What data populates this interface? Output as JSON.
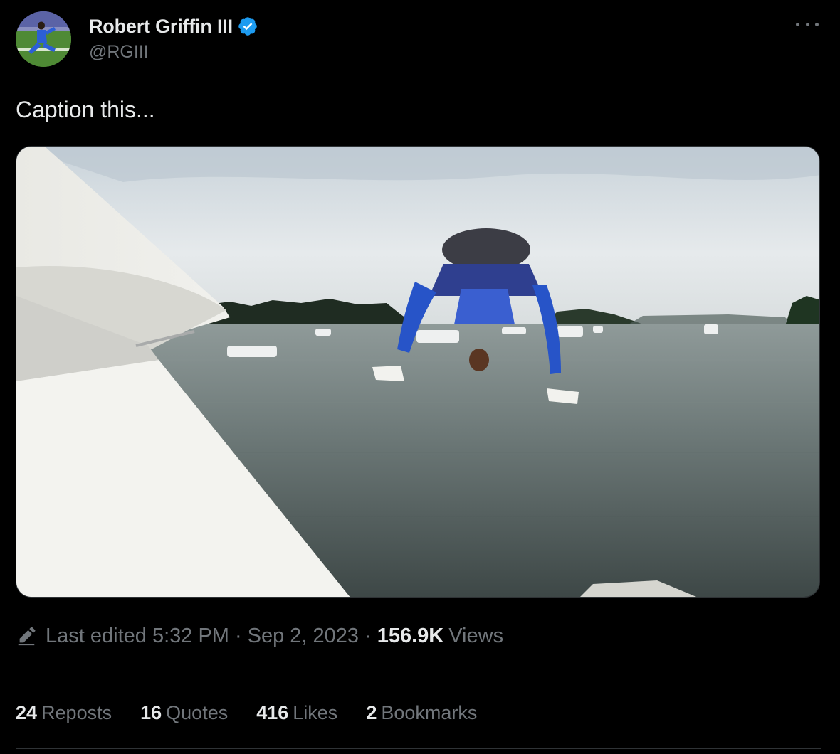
{
  "author": {
    "display_name": "Robert Griffin III",
    "handle": "@RGIII",
    "verified": true,
    "verified_icon": "verified-badge-icon",
    "avatar": "avatar-photo-football-player"
  },
  "menu": {
    "icon": "more-options-icon"
  },
  "tweet": {
    "text": "Caption this..."
  },
  "media": {
    "type": "photo",
    "icon": "photo-man-jumping-off-boat-into-lake"
  },
  "meta": {
    "edit_icon": "pencil-icon",
    "last_edited_label": "Last edited",
    "time": "5:32 PM",
    "separator": "·",
    "date": "Sep 2, 2023",
    "views_count": "156.9K",
    "views_label": "Views"
  },
  "stats": [
    {
      "count": "24",
      "label": "Reposts"
    },
    {
      "count": "16",
      "label": "Quotes"
    },
    {
      "count": "416",
      "label": "Likes"
    },
    {
      "count": "2",
      "label": "Bookmarks"
    }
  ],
  "colors": {
    "background": "#000000",
    "text": "#e7e9ea",
    "secondary_text": "#71767b",
    "verified_blue": "#1d9bf0",
    "divider": "#2f3336"
  }
}
